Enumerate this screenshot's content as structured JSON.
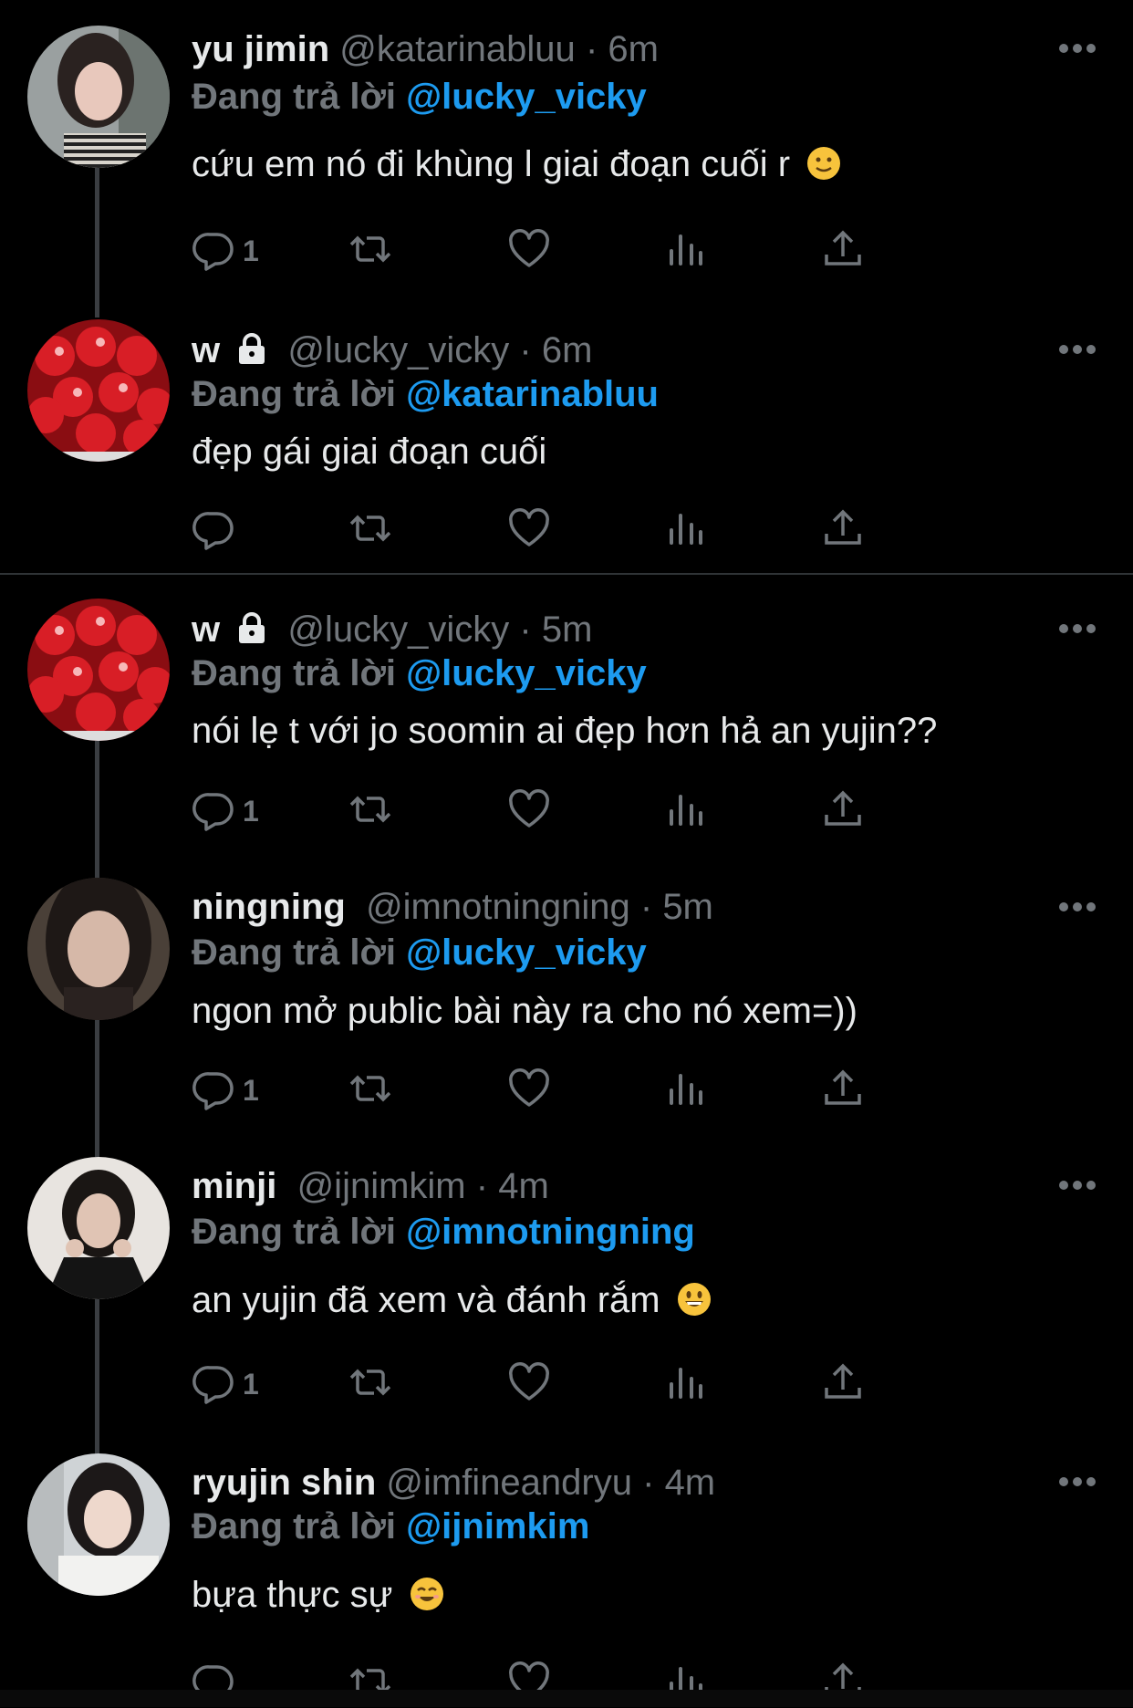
{
  "reply_prefix": "Đang trả lời",
  "tweets": [
    {
      "name": "yu jimin",
      "handle": "@katarinabluu",
      "time": "6m",
      "reply_to": "@lucky_vicky",
      "text": "cứu em nó đi khùng l giai đoạn cuối r",
      "emoji": "slightly-smiling-face",
      "reply_count": "1",
      "locked": false
    },
    {
      "name": "w",
      "handle": "@lucky_vicky",
      "time": "6m",
      "reply_to": "@katarinabluu",
      "text": "đẹp gái giai đoạn cuối",
      "emoji": "",
      "reply_count": "",
      "locked": true
    },
    {
      "name": "w",
      "handle": "@lucky_vicky",
      "time": "5m",
      "reply_to": "@lucky_vicky",
      "text": "nói lẹ t với jo soomin ai đẹp hơn hả an yujin??",
      "emoji": "",
      "reply_count": "1",
      "locked": true
    },
    {
      "name": "ningning",
      "handle": "@imnotningning",
      "time": "5m",
      "reply_to": "@lucky_vicky",
      "text": "ngon mở public bài này ra cho nó xem=))",
      "emoji": "",
      "reply_count": "1",
      "locked": false
    },
    {
      "name": "minji",
      "handle": "@ijnimkim",
      "time": "4m",
      "reply_to": "@imnotningning",
      "text": "an yujin đã xem và đánh rắm",
      "emoji": "grinning-face",
      "reply_count": "1",
      "locked": false
    },
    {
      "name": "ryujin shin",
      "handle": "@imfineandryu",
      "time": "4m",
      "reply_to": "@ijnimkim",
      "text": "bựa thực sự",
      "emoji": "smiling-face",
      "reply_count": "",
      "locked": false
    }
  ],
  "icons": {
    "reply": "reply-icon",
    "retweet": "retweet-icon",
    "like": "heart-icon",
    "views": "views-icon",
    "share": "share-icon",
    "more": "more-icon",
    "lock": "lock-icon"
  },
  "colors": {
    "background": "#000000",
    "text": "#e7e9ea",
    "muted": "#71767b",
    "mention": "#1d9bf0"
  }
}
